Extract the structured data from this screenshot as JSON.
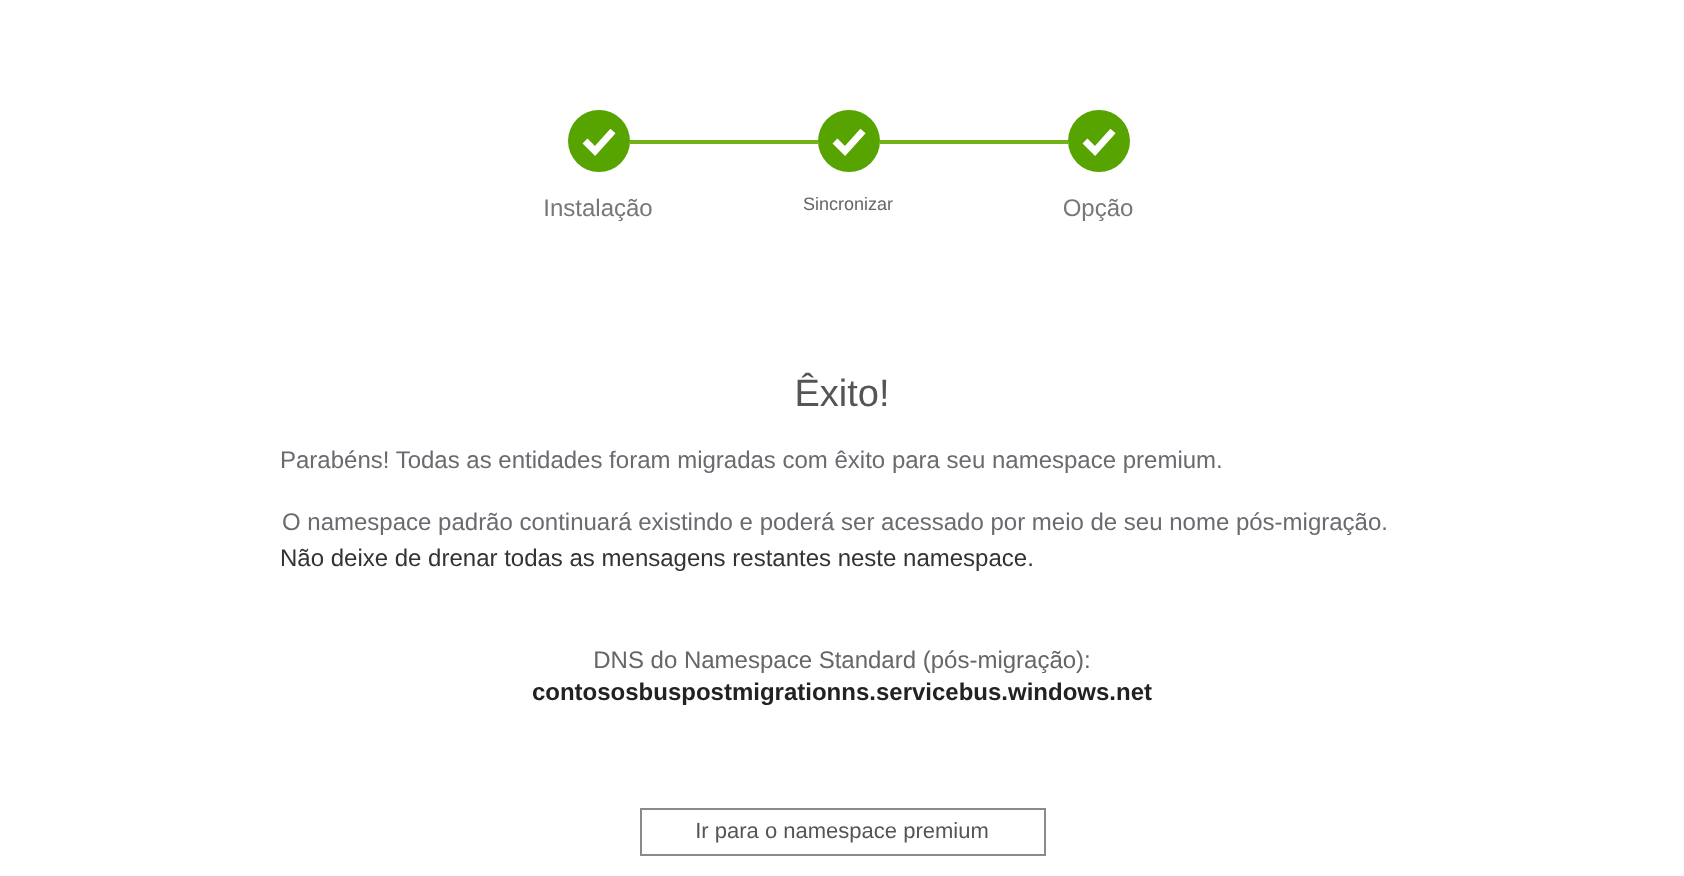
{
  "steps": [
    {
      "label": "Instalação",
      "completed": true
    },
    {
      "label": "Sincronizar",
      "completed": true
    },
    {
      "label": "Opção",
      "completed": true
    }
  ],
  "title": "Êxito!",
  "message": "Parabéns! Todas as entidades foram migradas com êxito para seu namespace premium.",
  "note": "O namespace padrão continuará existindo e poderá ser acessado por meio de seu nome pós-migração.",
  "warning": "Não deixe de drenar todas as mensagens restantes neste namespace.",
  "dns": {
    "label": "DNS do Namespace Standard (pós-migração):",
    "value": "contososbuspostmigrationns.servicebus.windows.net"
  },
  "button": "Ir para o namespace premium"
}
